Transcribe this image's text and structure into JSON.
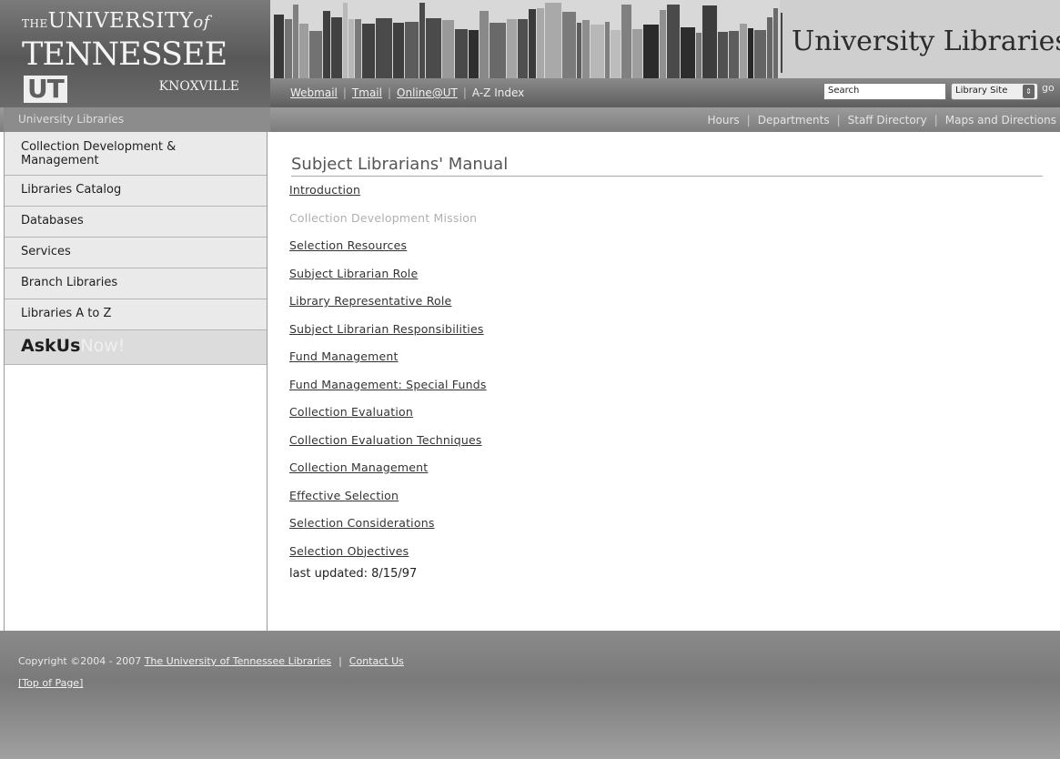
{
  "logo": {
    "line1_the": "THE",
    "line1_univ": "UNIVERSITY",
    "line1_of": "of",
    "line2": "TENNESSEE",
    "badge": "UT",
    "line3": "KNOXVILLE"
  },
  "site_title": "University Libraries",
  "top_links": [
    "Webmail",
    "Tmail",
    "Online@UT",
    "A-Z Index"
  ],
  "search": {
    "value": "Search",
    "scope": "Library Site",
    "go": "go"
  },
  "breadcrumb": "University Libraries",
  "nav_links": [
    "Hours",
    "Departments",
    "Staff Directory",
    "Maps and Directions"
  ],
  "sidebar": {
    "items": [
      "Collection Development & Management",
      "Libraries Catalog",
      "Databases",
      "Services",
      "Branch Libraries",
      "Libraries A to Z"
    ],
    "askus_a": "AskUs",
    "askus_b": "Now!"
  },
  "main": {
    "title": "Subject Librarians' Manual",
    "links": [
      "Introduction",
      "Collection Development Mission",
      "Selection Resources",
      "Subject Librarian Role",
      "Library Representative Role",
      "Subject Librarian Responsibilities",
      "Fund Management",
      "Fund Management: Special Funds",
      "Collection Evaluation",
      "Collection Evaluation Techniques",
      "Collection Management",
      "Effective Selection",
      "Selection Considerations",
      "Selection Objectives"
    ],
    "updated": "last updated: 8/15/97"
  },
  "footer": {
    "copyright": "Copyright ©2004 - 2007",
    "library_link": "The University of Tennessee Libraries",
    "contact": "Contact Us",
    "top": "[Top of Page]"
  }
}
